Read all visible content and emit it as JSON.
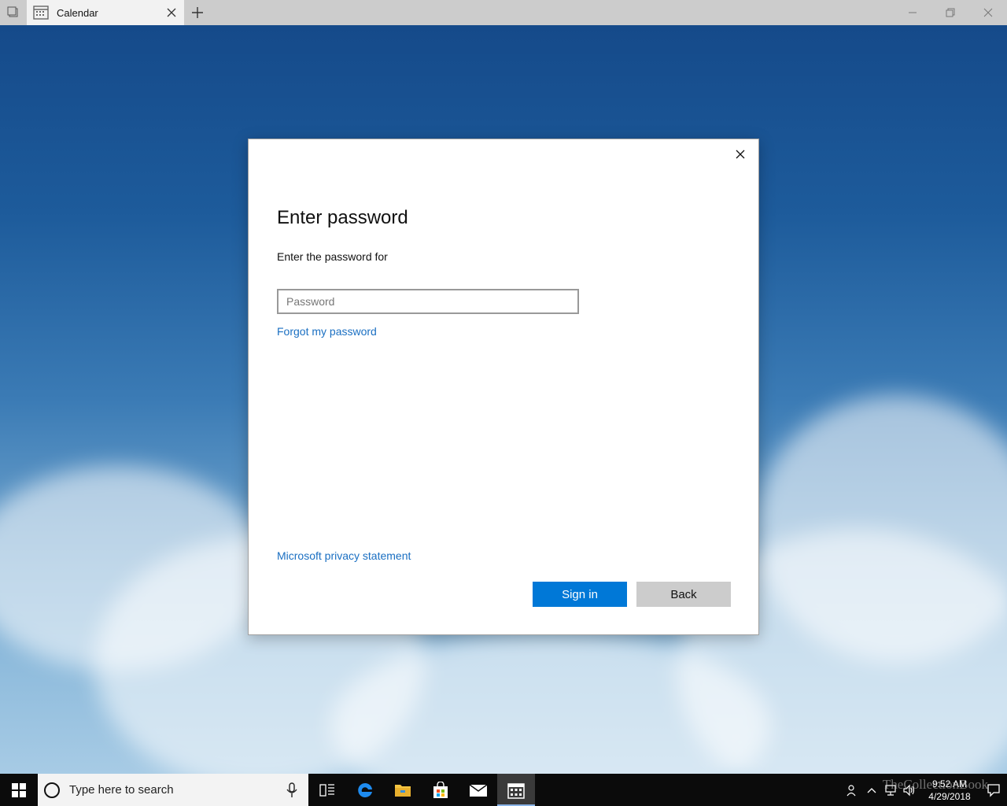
{
  "tab": {
    "title": "Calendar"
  },
  "dialog": {
    "title": "Enter password",
    "subtitle": "Enter the password for",
    "password_placeholder": "Password",
    "forgot_link": "Forgot my password",
    "privacy_link": "Microsoft privacy statement",
    "sign_in_label": "Sign in",
    "back_label": "Back"
  },
  "taskbar": {
    "search_placeholder": "Type here to search",
    "apps": [
      "task-view-icon",
      "edge-icon",
      "file-explorer-icon",
      "store-icon",
      "mail-icon",
      "calendar-icon"
    ],
    "active_app": "calendar-icon"
  },
  "tray": {
    "time": "9:52 AM",
    "date": "4/29/2018"
  },
  "watermark": "TheCollectionBook",
  "colors": {
    "accent": "#0078d7",
    "link": "#1a6fc2",
    "taskbar": "#0b0b0b"
  }
}
